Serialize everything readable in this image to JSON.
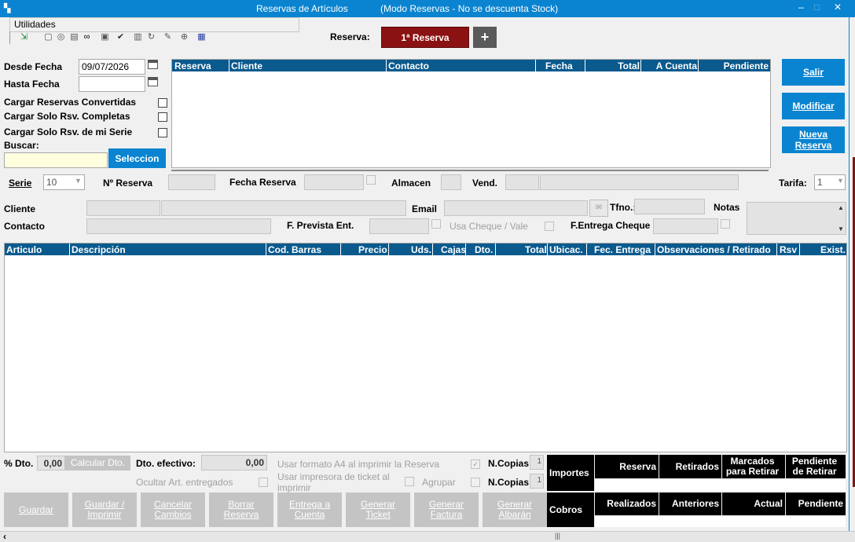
{
  "window": {
    "title": "Reservas de Artículos",
    "mode": "(Modo Reservas - No se descuenta Stock)",
    "minimize": "–",
    "maximize": "□",
    "close": "✕"
  },
  "menu": {
    "utilities": "Utilidades"
  },
  "toolbar_icons": [
    "exit-icon",
    "new-doc-icon",
    "copy-icon",
    "print-icon",
    "binoculars-icon",
    "clipboard-icon",
    "check-icon",
    "printer-icon",
    "refresh-icon",
    "edit-icon",
    "search-doc-icon",
    "notes-icon"
  ],
  "reserva_header": {
    "label": "Reserva:",
    "button": "1ª Reserva",
    "add": "+"
  },
  "filters": {
    "desde_fecha_label": "Desde Fecha",
    "desde_fecha_value": "09/07/2026",
    "hasta_fecha_label": "Hasta Fecha",
    "hasta_fecha_value": "",
    "cargar_convertidas": "Cargar Reservas Convertidas",
    "cargar_completas": "Cargar Solo Rsv. Completas",
    "cargar_serie": "Cargar Solo Rsv. de mi Serie",
    "buscar_label": "Buscar:",
    "buscar_value": "",
    "seleccion_button": "Seleccion"
  },
  "reservas_grid": {
    "columns": [
      "Reserva",
      "Cliente",
      "Contacto",
      "Fecha",
      "Total",
      "A Cuenta",
      "Pendiente"
    ],
    "rows": []
  },
  "side_buttons": {
    "salir": "Salir",
    "modificar": "Modificar",
    "nueva_reserva": "Nueva Reserva"
  },
  "form": {
    "serie_label": "Serie",
    "serie_value": "10",
    "n_reserva_label": "Nº Reserva",
    "fecha_reserva_label": "Fecha Reserva",
    "almacen_label": "Almacen",
    "vend_label": "Vend.",
    "tarifa_label": "Tarifa:",
    "tarifa_value": "1",
    "cliente_label": "Cliente",
    "email_label": "Email",
    "tfno_label": "Tfno.:",
    "notas_label": "Notas",
    "contacto_label": "Contacto",
    "f_prevista_label": "F. Prevista Ent.",
    "usa_cheque_label": "Usa Cheque / Vale",
    "f_entrega_cheque_label": "F.Entrega Cheque"
  },
  "articles_grid": {
    "columns": [
      "Articulo",
      "Descripción",
      "Cod. Barras",
      "Precio",
      "Uds.",
      "Cajas",
      "Dto.",
      "Total",
      "Ubicac.",
      "Fec. Entrega",
      "Observaciones / Retirado",
      "Rsv",
      "Exist."
    ],
    "rows": []
  },
  "footer": {
    "dto_label": "% Dto.",
    "dto_value": "0,00",
    "calcular_dto": "Calcular Dto.",
    "dto_efectivo_label": "Dto. efectivo:",
    "dto_efectivo_value": "0,00",
    "formato_a4": "Usar formato A4 al imprimir la Reserva",
    "ocultar_art": "Ocultar Art. entregados",
    "impresora_ticket": "Usar impresora de ticket al imprimir",
    "agrupar": "Agrupar",
    "ncopias_label": "N.Copias",
    "ncopias_1": "1",
    "ncopias_2": "1"
  },
  "action_buttons": [
    "Guardar",
    "Guardar / Imprimir",
    "Cancelar Cambios",
    "Borrar Reserva",
    "Entrega a Cuenta",
    "Generar Ticket",
    "Generar Factura",
    "Generar Albarán"
  ],
  "summary": {
    "importes": "Importes",
    "cobros": "Cobros",
    "headers_top": [
      "Reserva",
      "Retirados",
      "Marcados para Retirar",
      "Pendiente de Retirar"
    ],
    "headers_bottom": [
      "Realizados",
      "Anteriores",
      "Actual",
      "Pendiente"
    ]
  },
  "scroll": {
    "left_arrow": "‹",
    "grip": "|||"
  }
}
